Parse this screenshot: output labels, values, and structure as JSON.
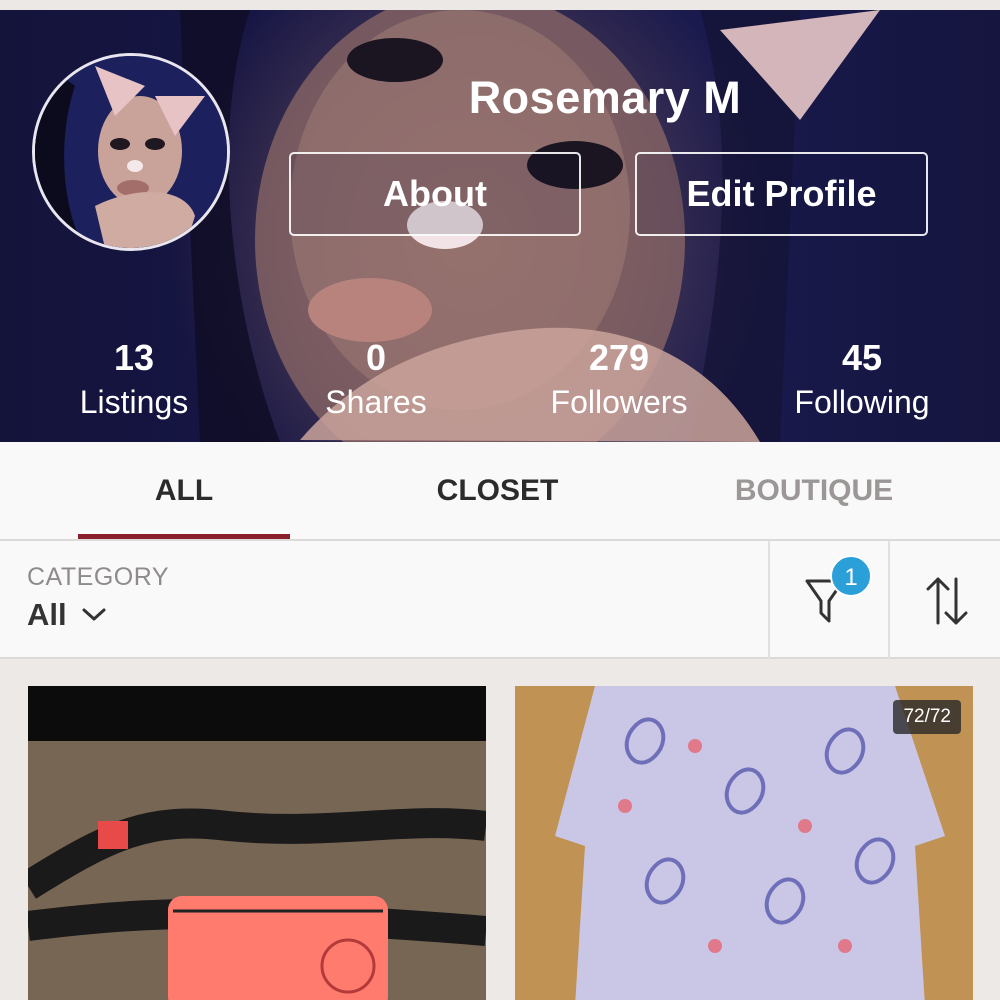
{
  "profile": {
    "name": "Rosemary M",
    "about_label": "About",
    "edit_profile_label": "Edit Profile"
  },
  "stats": [
    {
      "value": "13",
      "label": "Listings"
    },
    {
      "value": "0",
      "label": "Shares"
    },
    {
      "value": "279",
      "label": "Followers"
    },
    {
      "value": "45",
      "label": "Following"
    }
  ],
  "tabs": [
    {
      "label": "ALL",
      "active": true
    },
    {
      "label": "CLOSET",
      "active": false
    },
    {
      "label": "BOUTIQUE",
      "active": false
    }
  ],
  "filter": {
    "category_label": "CATEGORY",
    "category_value": "All",
    "filter_count": "1",
    "filter_icon": "filter-icon",
    "sort_icon": "sort-arrows-icon",
    "dropdown_icon": "chevron-down-icon"
  },
  "listings": [
    {
      "image_description_icon": "listing-photo",
      "counter": ""
    },
    {
      "image_description_icon": "listing-photo",
      "counter": "72/72"
    }
  ],
  "colors": {
    "accent": "#8a1f2e",
    "badge": "#2a9fd8",
    "tab_active": "#2b2b2b",
    "tab_inactive": "#9a9796"
  }
}
